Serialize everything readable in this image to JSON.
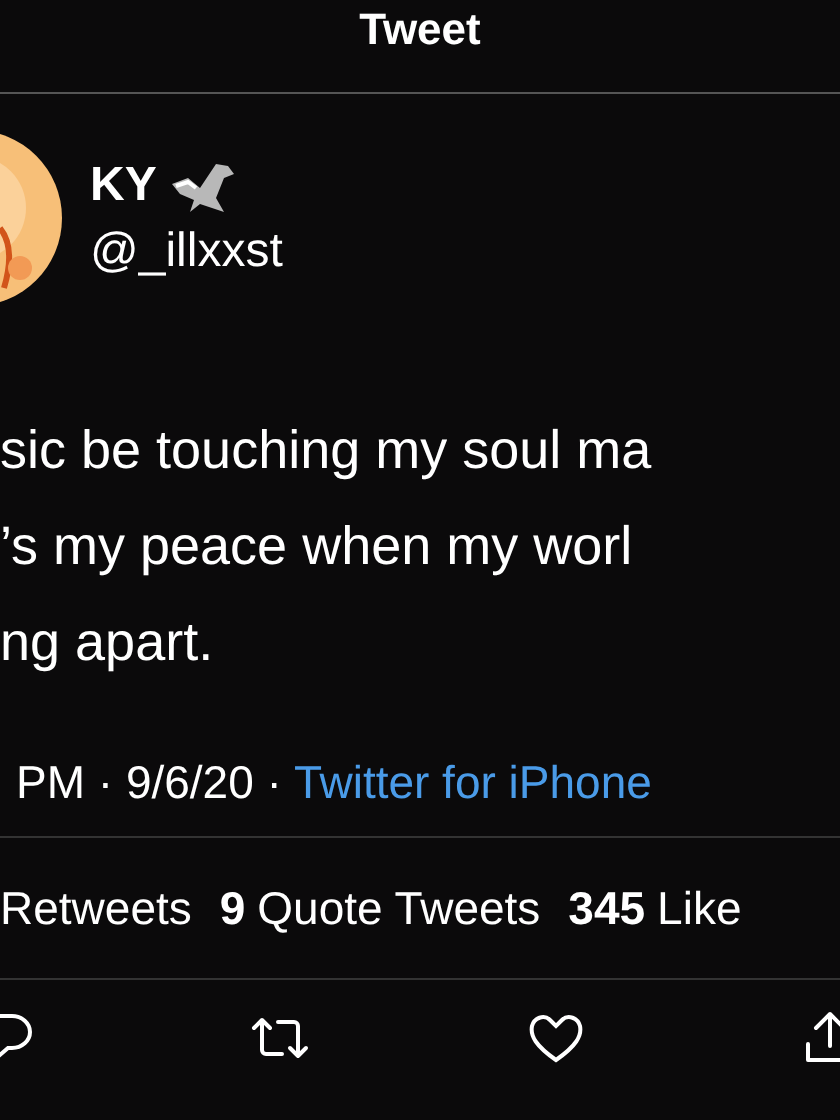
{
  "header": {
    "title": "Tweet"
  },
  "author": {
    "name": "KY",
    "handle": "@_illxxst"
  },
  "text_lines": [
    "sic be touching my soul ma",
    "’s my peace when my worl",
    "ng apart."
  ],
  "meta": {
    "timestamp": "PM · 9/6/20 ·",
    "source": "Twitter for iPhone"
  },
  "stats": [
    {
      "label": "Retweets"
    },
    {
      "count": "9",
      "label": "Quote Tweets"
    },
    {
      "count": "345",
      "label": "Like"
    }
  ],
  "actions": [
    {
      "kind": "reply"
    },
    {
      "kind": "retweet"
    },
    {
      "kind": "like"
    },
    {
      "kind": "share"
    }
  ]
}
